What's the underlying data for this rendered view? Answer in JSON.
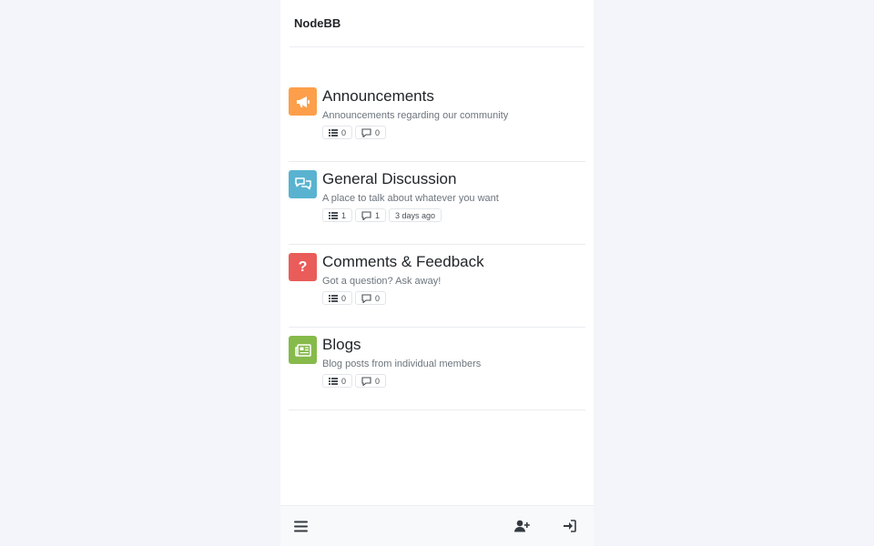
{
  "header": {
    "brand": "NodeBB"
  },
  "categories": [
    {
      "title": "Announcements",
      "description": "Announcements regarding our community",
      "icon": "bullhorn-icon",
      "color": "#fd9f4a",
      "topics": "0",
      "posts": "0",
      "last_post": ""
    },
    {
      "title": "General Discussion",
      "description": "A place to talk about whatever you want",
      "icon": "comments-icon",
      "color": "#59b3d0",
      "topics": "1",
      "posts": "1",
      "last_post": "3 days ago"
    },
    {
      "title": "Comments & Feedback",
      "description": "Got a question? Ask away!",
      "icon": "question-icon",
      "color": "#e95c5a",
      "topics": "0",
      "posts": "0",
      "last_post": ""
    },
    {
      "title": "Blogs",
      "description": "Blog posts from individual members",
      "icon": "newspaper-icon",
      "color": "#86ba4b",
      "topics": "0",
      "posts": "0",
      "last_post": ""
    }
  ],
  "footer": {
    "icons": [
      "menu-icon",
      "register-icon",
      "login-icon"
    ]
  }
}
